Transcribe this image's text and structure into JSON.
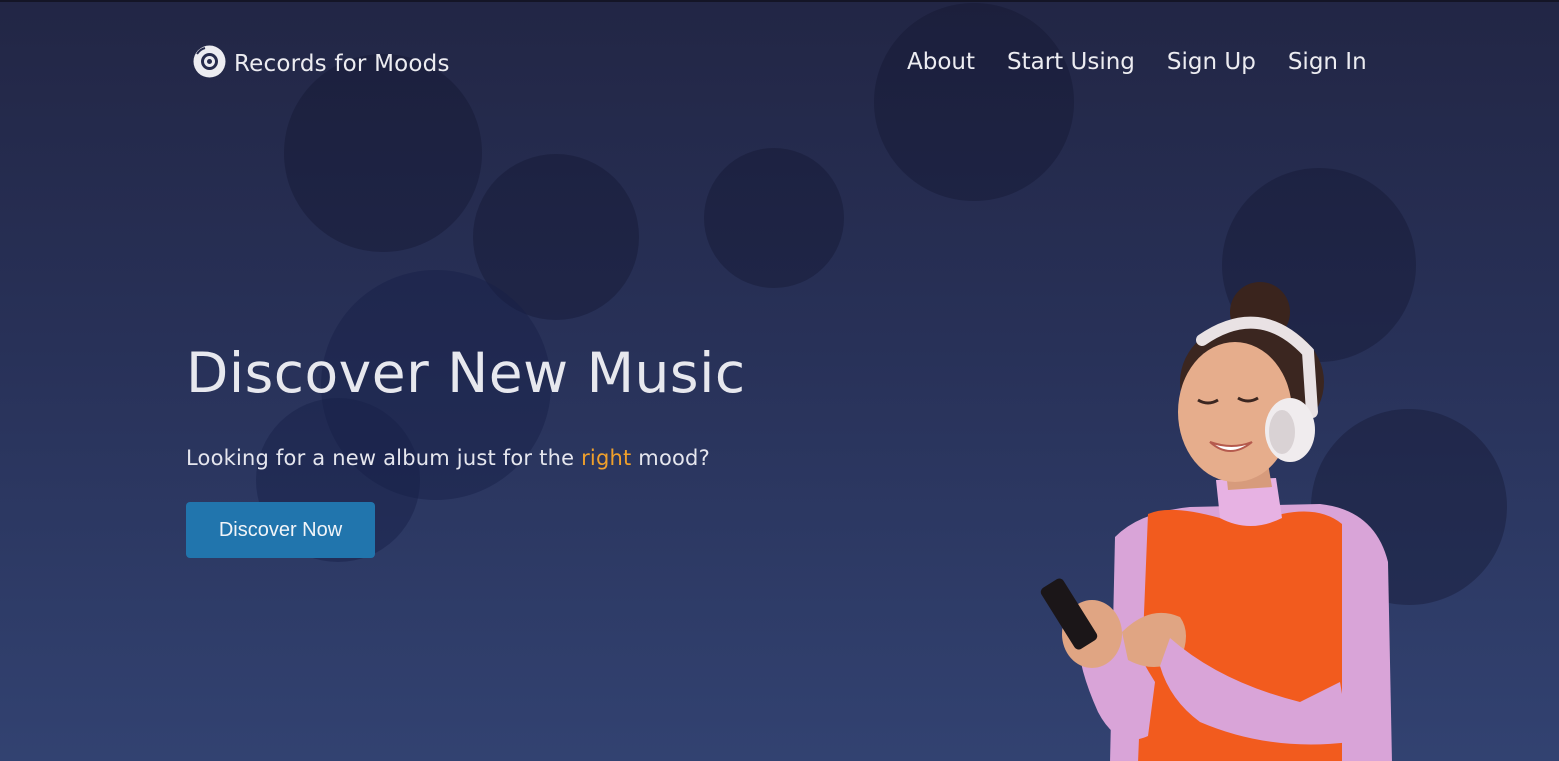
{
  "brand": {
    "name": "Records for Moods",
    "icon": "vinyl-record-icon"
  },
  "nav": {
    "links": [
      {
        "label": "About"
      },
      {
        "label": "Start Using"
      },
      {
        "label": "Sign Up"
      },
      {
        "label": "Sign In"
      }
    ]
  },
  "hero": {
    "title": "Discover New Music",
    "subtitle_before": "Looking for a new album just for the ",
    "subtitle_accent": "right",
    "subtitle_after": " mood?",
    "cta_label": "Discover Now",
    "illustration": "woman-with-headphones-using-phone"
  },
  "colors": {
    "background_top": "#222645",
    "background_bottom": "#324271",
    "accent": "#f0a02b",
    "button": "#2175ad",
    "text": "#ececf1"
  }
}
